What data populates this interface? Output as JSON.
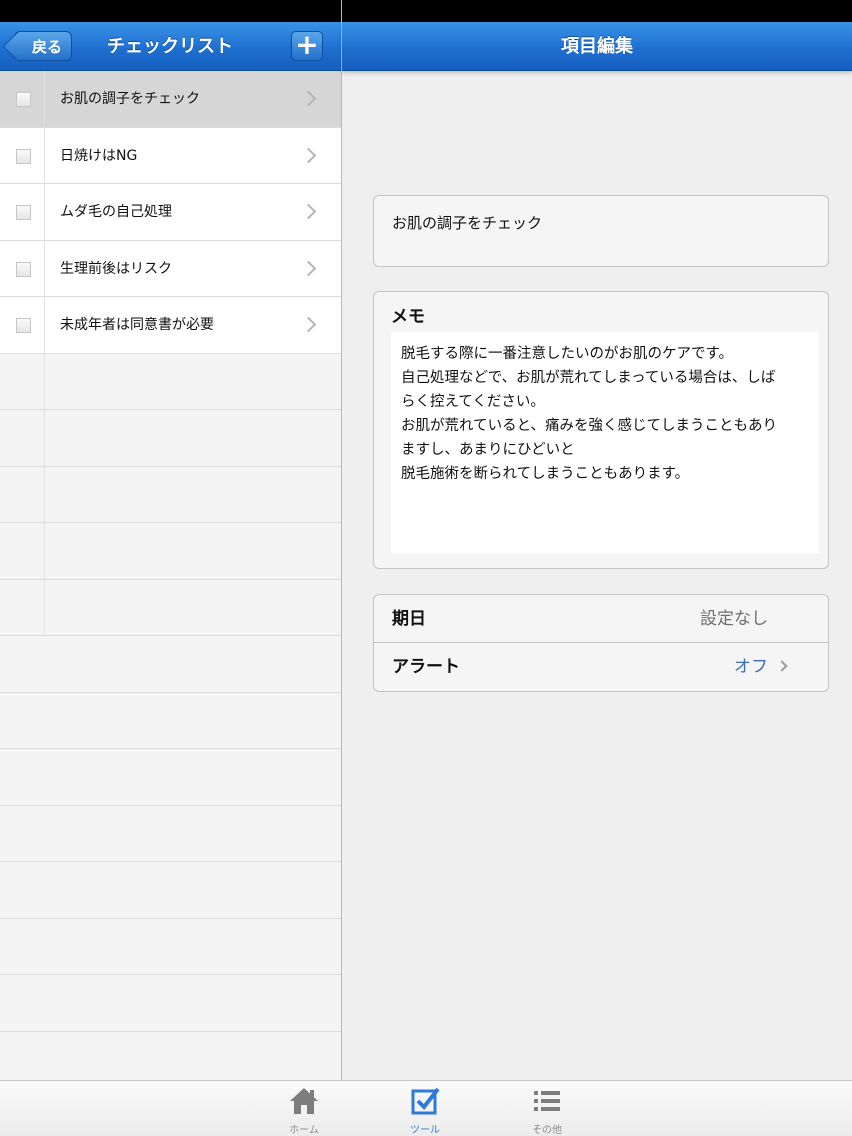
{
  "left": {
    "back_label": "戻る",
    "title": "チェックリスト",
    "add_label": "+",
    "items": [
      {
        "label": "お肌の調子をチェック"
      },
      {
        "label": "日焼けはNG"
      },
      {
        "label": "ムダ毛の自己処理"
      },
      {
        "label": "生理前後はリスク"
      },
      {
        "label": "未成年者は同意書が必要"
      }
    ]
  },
  "right": {
    "title": "項目編集",
    "item_title": "お肌の調子をチェック",
    "memo_heading": "メモ",
    "memo_lines": [
      "脱毛する際に一番注意したいのがお肌のケアです。",
      "自己処理などで、お肌が荒れてしまっている場合は、しば",
      "らく控えてください。",
      "お肌が荒れていると、痛みを強く感じてしまうこともあり",
      "ますし、あまりにひどいと",
      "脱毛施術を断られてしまうこともあります。"
    ],
    "due_label": "期日",
    "due_value": "設定なし",
    "alert_label": "アラート",
    "alert_value": "オフ"
  },
  "tabs": [
    {
      "label": "ホーム",
      "icon": "home-icon"
    },
    {
      "label": "ツール",
      "icon": "checkbox-icon"
    },
    {
      "label": "その他",
      "icon": "list-icon"
    }
  ],
  "colors": {
    "nav_blue": "#1f6fd0",
    "active_tab": "#2e7bd6",
    "alert_value": "#3a6fb8"
  }
}
